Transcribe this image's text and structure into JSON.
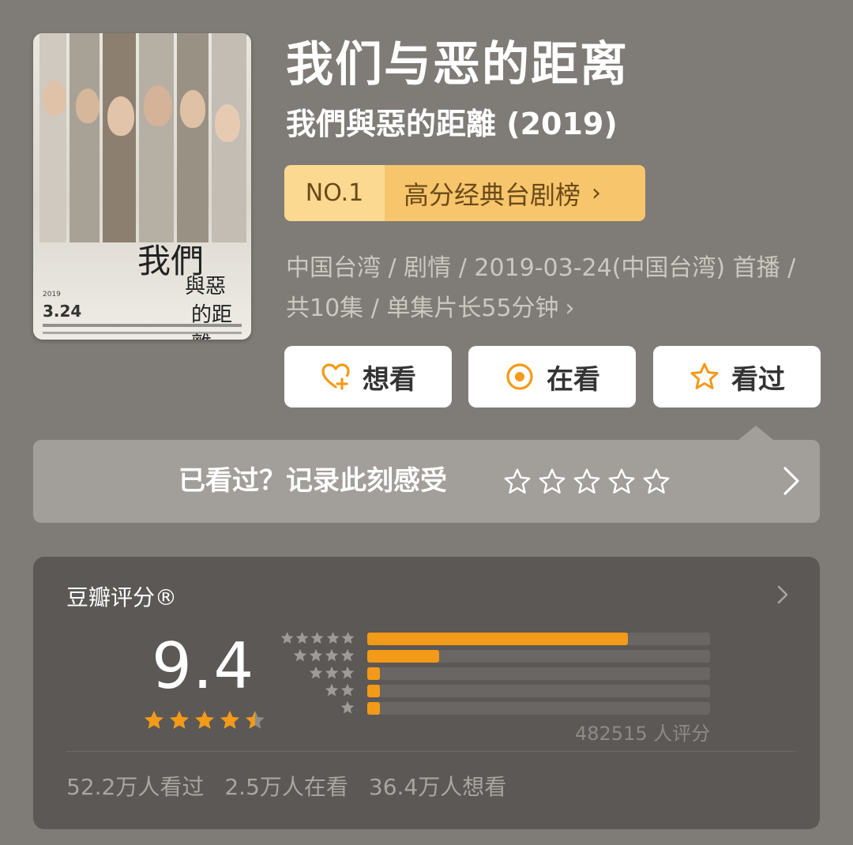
{
  "show": {
    "title": "我们与恶的距离",
    "subtitle": "我們與惡的距離 (2019)"
  },
  "poster": {
    "title_line1": "我們",
    "title_line2": "與惡",
    "title_line3": "的距離",
    "year": "2019",
    "date": "3.24"
  },
  "rank": {
    "number": "NO.1",
    "list_name": "高分经典台剧榜",
    "chevron": "›"
  },
  "meta": {
    "line1": "中国台湾 / 剧情 / 2019-03-24(中国台湾) 首播 /",
    "line2": "共10集 / 单集片长55分钟",
    "chevron": "›"
  },
  "actions": {
    "want": "想看",
    "watching": "在看",
    "watched": "看过"
  },
  "rate_prompt": {
    "text": "已看过？记录此刻感受"
  },
  "rating": {
    "header": "豆瓣评分®",
    "score": "9.4",
    "score_stars": 4.5,
    "raters": "482515 人评分",
    "distribution": [
      {
        "stars": 5,
        "fraction": 0.76
      },
      {
        "stars": 4,
        "fraction": 0.21
      },
      {
        "stars": 3,
        "fraction": 0.03
      },
      {
        "stars": 2,
        "fraction": 0.01
      },
      {
        "stars": 1,
        "fraction": 0.01
      }
    ],
    "stats": {
      "watched": "52.2万人看过",
      "watching": "2.5万人在看",
      "want": "36.4万人想看"
    }
  },
  "colors": {
    "background": "#7f7b76",
    "accent_orange": "#f39a18",
    "rank_gold": "#f7c56b",
    "card_dark": "#5b5855"
  }
}
